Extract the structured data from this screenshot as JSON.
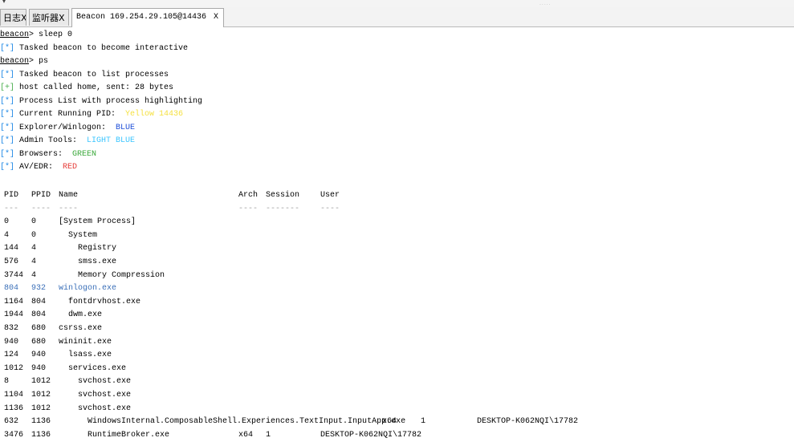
{
  "window": {
    "collapse_arrow": "▾",
    "grip": "....."
  },
  "tabs": [
    {
      "label": "日志X"
    },
    {
      "label": "监听器X"
    },
    {
      "label": "Beacon 169.254.29.105@14436",
      "close": "X"
    }
  ],
  "console": {
    "cmd1_prompt": "beacon",
    "cmd1_text": "> sleep 0",
    "msg1_tag": "[*]",
    "msg1_text": " Tasked beacon to become interactive",
    "cmd2_prompt": "beacon",
    "cmd2_text": "> ps",
    "msg2_tag": "[*]",
    "msg2_text": " Tasked beacon to list processes",
    "msg3_tag": "[+]",
    "msg3_text": " host called home, sent: 28 bytes",
    "msg4_tag": "[*]",
    "msg4_text": " Process List with process highlighting",
    "msg5_tag": "[*]",
    "msg5_text": " Current Running PID:  ",
    "msg5_value": "Yellow 14436",
    "msg6_tag": "[*]",
    "msg6_text": " Explorer/Winlogon:  ",
    "msg6_value": "BLUE",
    "msg7_tag": "[*]",
    "msg7_text": " Admin Tools:  ",
    "msg7_value": "LIGHT BLUE",
    "msg8_tag": "[*]",
    "msg8_text": " Browsers:  ",
    "msg8_value": "GREEN",
    "msg9_tag": "[*]",
    "msg9_text": " AV/EDR:  ",
    "msg9_value": "RED"
  },
  "table": {
    "headers": {
      "pid": "PID",
      "ppid": "PPID",
      "name": "Name",
      "arch": "Arch",
      "session": "Session",
      "user": "User"
    },
    "dashes": {
      "pid": "---",
      "ppid": "----",
      "name": "----",
      "arch": "----",
      "session": "-------",
      "user": "----"
    },
    "rows": [
      {
        "pid": "0",
        "ppid": "0",
        "name": "[System Process]",
        "arch": "",
        "session": "",
        "user": ""
      },
      {
        "pid": "4",
        "ppid": "0",
        "name": "  System",
        "arch": "",
        "session": "",
        "user": ""
      },
      {
        "pid": "144",
        "ppid": "4",
        "name": "    Registry",
        "arch": "",
        "session": "",
        "user": ""
      },
      {
        "pid": "576",
        "ppid": "4",
        "name": "    smss.exe",
        "arch": "",
        "session": "",
        "user": ""
      },
      {
        "pid": "3744",
        "ppid": "4",
        "name": "    Memory Compression",
        "arch": "",
        "session": "",
        "user": ""
      },
      {
        "pid": "804",
        "ppid": "932",
        "name": "winlogon.exe",
        "arch": "",
        "session": "",
        "user": ""
      },
      {
        "pid": "1164",
        "ppid": "804",
        "name": "  fontdrvhost.exe",
        "arch": "",
        "session": "",
        "user": ""
      },
      {
        "pid": "1944",
        "ppid": "804",
        "name": "  dwm.exe",
        "arch": "",
        "session": "",
        "user": ""
      },
      {
        "pid": "832",
        "ppid": "680",
        "name": "csrss.exe",
        "arch": "",
        "session": "",
        "user": ""
      },
      {
        "pid": "940",
        "ppid": "680",
        "name": "wininit.exe",
        "arch": "",
        "session": "",
        "user": ""
      },
      {
        "pid": "124",
        "ppid": "940",
        "name": "  lsass.exe",
        "arch": "",
        "session": "",
        "user": ""
      },
      {
        "pid": "1012",
        "ppid": "940",
        "name": "  services.exe",
        "arch": "",
        "session": "",
        "user": ""
      },
      {
        "pid": "8",
        "ppid": "1012",
        "name": "    svchost.exe",
        "arch": "",
        "session": "",
        "user": ""
      },
      {
        "pid": "1104",
        "ppid": "1012",
        "name": "    svchost.exe",
        "arch": "",
        "session": "",
        "user": ""
      },
      {
        "pid": "1136",
        "ppid": "1012",
        "name": "    svchost.exe",
        "arch": "",
        "session": "",
        "user": ""
      },
      {
        "pid": "632",
        "ppid": "1136",
        "name": "      WindowsInternal.ComposableShell.Experiences.TextInput.InputApp.exe",
        "arch": "x64",
        "session": "1",
        "user": "DESKTOP-K062NQI\\17782"
      },
      {
        "pid": "3476",
        "ppid": "1136",
        "name": "      RuntimeBroker.exe",
        "arch": "x64",
        "session": "1",
        "user": "DESKTOP-K062NQI\\17782"
      }
    ]
  },
  "colors": {
    "tag_info": "#1e88e5",
    "tag_ok": "#4caf50",
    "current_pid": "#f5e142",
    "explorer_winlogon": "#1f4fd8",
    "admin_tools": "#3cc6ff",
    "browsers": "#3aa83a",
    "av_edr": "#e53935",
    "highlighted_row": "#3a6fb8"
  }
}
